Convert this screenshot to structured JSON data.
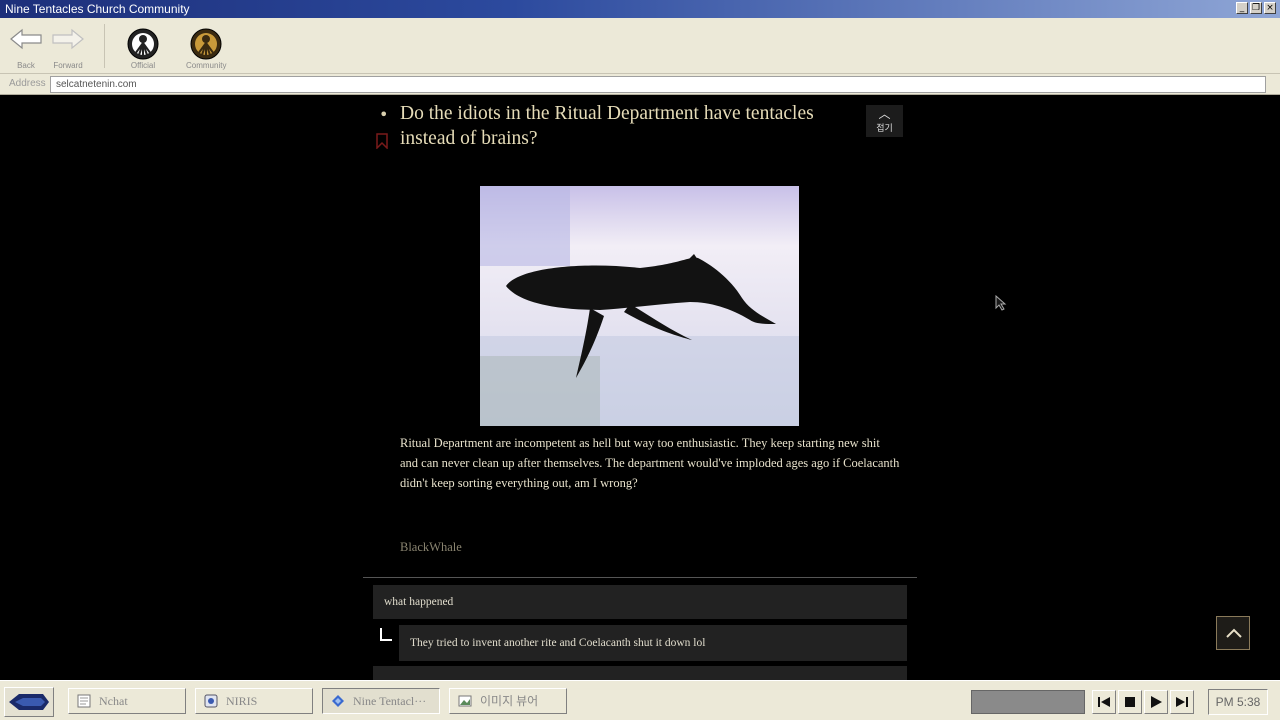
{
  "window": {
    "title": "Nine Tentacles Church Community"
  },
  "toolbar": {
    "back_label": "Back",
    "forward_label": "Forward",
    "official_label": "Official",
    "community_label": "Community"
  },
  "address_bar": {
    "label": "Address",
    "url": "selcatnetenin.com"
  },
  "post": {
    "title": "Do the idiots in the Ritual Department have tentacles instead of brains?",
    "fold_label": "접기",
    "body": "Ritual Department are incompetent as hell but way too enthusiastic. They keep starting new shit and can never clean up after themselves. The department would've imploded ages ago if Coelacanth didn't keep sorting everything out, am I wrong?",
    "author": "BlackWhale"
  },
  "comments": [
    {
      "text": "what happened"
    },
    {
      "text": "They tried to invent another rite and Coelacanth shut it down lol"
    }
  ],
  "taskbar": {
    "tasks": [
      {
        "label": "Nchat",
        "icon": "notepad-icon"
      },
      {
        "label": "NIRIS",
        "icon": "niris-icon"
      },
      {
        "label": "Nine Tentacl···",
        "icon": "browser-icon",
        "active": true
      },
      {
        "label": "이미지 뷰어",
        "icon": "image-viewer-icon"
      }
    ],
    "clock": "PM 5:38"
  },
  "colors": {
    "title_text": "#e6dcb8",
    "body_text": "#e8e2cc",
    "author_text": "#8a8470",
    "comment_bg": "#222222",
    "titlebar_start": "#1d2f7a",
    "chrome": "#ece9d8"
  }
}
